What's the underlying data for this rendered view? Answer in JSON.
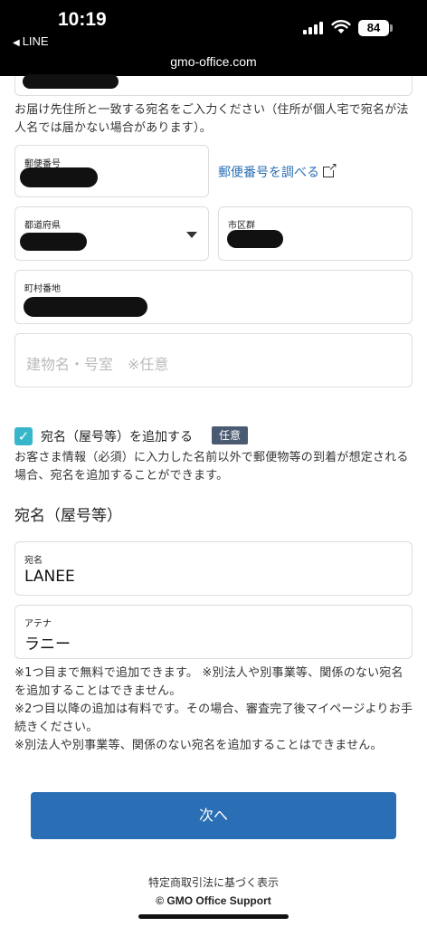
{
  "status_bar": {
    "time": "10:19",
    "back_app": "LINE",
    "battery": "84",
    "url": "gmo-office.com"
  },
  "address_note": "お届け先住所と一致する宛名をご入力ください（住所が個人宅で宛名が法人名では届かない場合があります）。",
  "postal": {
    "label": "郵便番号",
    "lookup_link": "郵便番号を調べる"
  },
  "prefecture": {
    "label": "都道府県"
  },
  "city": {
    "label": "市区群"
  },
  "town": {
    "label": "町村番地"
  },
  "building": {
    "placeholder": "建物名・号室　※任意"
  },
  "add_recipient": {
    "checked": true,
    "label": "宛名（屋号等）を追加する",
    "badge": "任意",
    "note": "お客さま情報（必須）に入力した名前以外で郵便物等の到着が想定される場合、宛名を追加することができます。"
  },
  "recipient_section": {
    "title": "宛名（屋号等）",
    "name_label": "宛名",
    "name_value": "LANEE",
    "attention_label": "アテナ",
    "attention_value": "ラニー"
  },
  "notes": [
    "※1つ目まで無料で追加できます。 ※別法人や別事業等、関係のない宛名を追加することはできません。",
    "※2つ目以降の追加は有料です。その場合、審査完了後マイページよりお手続きください。",
    "※別法人や別事業等、関係のない宛名を追加することはできません。"
  ],
  "next_button": "次へ",
  "footer_link": "特定商取引法に基づく表示",
  "copyright": "© GMO Office Support"
}
